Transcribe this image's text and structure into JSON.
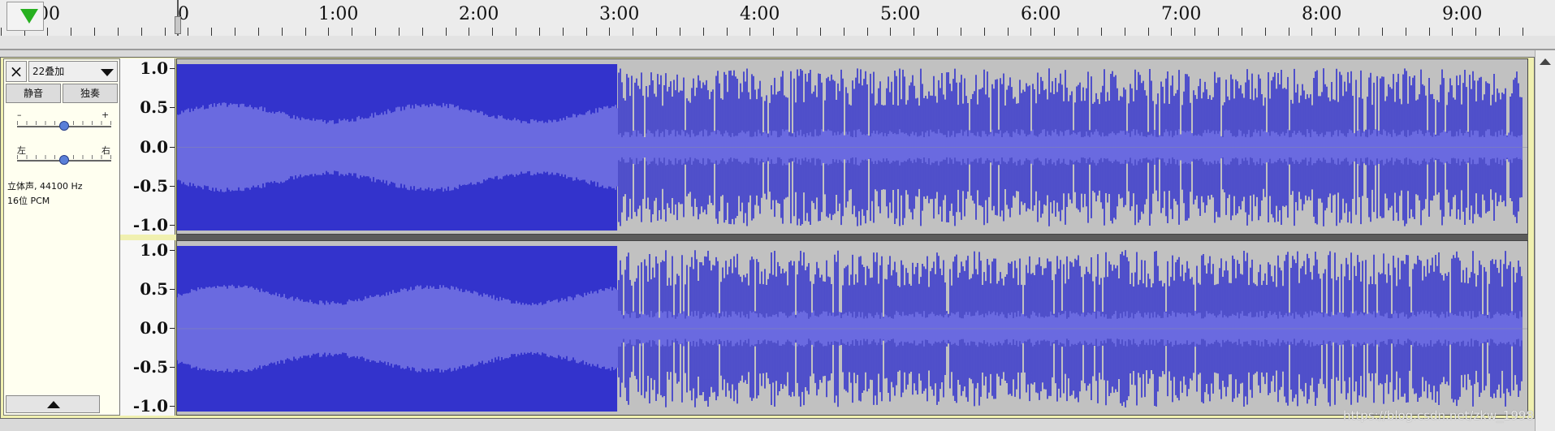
{
  "timeline": {
    "labels": [
      "00",
      "0",
      "1:00",
      "2:00",
      "3:00",
      "4:00",
      "5:00",
      "6:00",
      "7:00",
      "8:00",
      "9:00"
    ],
    "seconds_visible": [
      -60,
      0,
      60,
      120,
      180,
      240,
      300,
      360,
      420,
      480,
      540
    ],
    "view_start_seconds": -75,
    "view_end_seconds": 580,
    "play_icon": "play-triangle-icon",
    "play_color": "#27b020"
  },
  "track": {
    "close_label": "×",
    "name": "22叠加",
    "mute_label": "静音",
    "solo_label": "独奏",
    "gain_minus": "–",
    "gain_plus": "+",
    "pan_left": "左",
    "pan_right": "右",
    "gain_level": 0.5,
    "pan_level": 0.5,
    "info_line1": "立体声, 44100 Hz",
    "info_line2": "16位 PCM",
    "collapse_icon": "collapse-up-icon"
  },
  "scale": {
    "labels": [
      "1.0",
      "0.5",
      "0.0",
      "-0.5",
      "-1.0"
    ],
    "values": [
      1.0,
      0.5,
      0.0,
      -0.5,
      -1.0
    ]
  },
  "waveform": {
    "peak_color": "#3333cc",
    "rms_color": "#6a6ae0",
    "background_color": "#c1c1c1",
    "dense_section_end_seconds": 188,
    "track_end_seconds": 575
  },
  "watermark": "https://blog.csdn.net/zkw_1998"
}
